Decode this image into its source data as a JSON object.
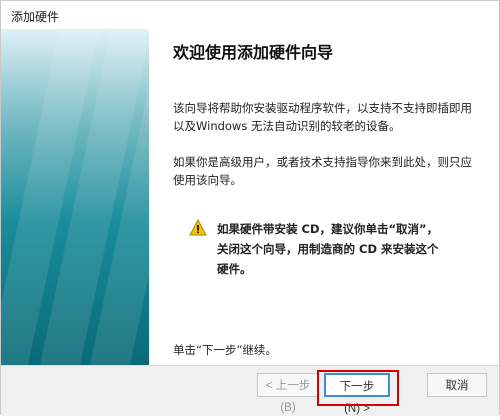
{
  "window": {
    "title": "添加硬件"
  },
  "content": {
    "heading": "欢迎使用添加硬件向导",
    "paragraph1": "该向导将帮助你安装驱动程序软件，以支持不支持即插即用以及Windows 无法自动识别的较老的设备。",
    "paragraph2": "如果你是高级用户，或者技术支持指导你来到此处，则只应使用该向导。",
    "warning": "如果硬件带安装 CD，建议你单击“取消”，关闭这个向导，用制造商的 CD 来安装这个硬件。",
    "continue_hint": "单击“下一步”继续。"
  },
  "buttons": {
    "back": "< 上一步(B)",
    "next": "下一步(N) >",
    "cancel": "取消"
  },
  "colors": {
    "highlight": "#d40000",
    "sidebar_dark": "#0a6a77",
    "warning_fill": "#f5c400"
  },
  "icons": {
    "warning": "warning-triangle-icon"
  }
}
